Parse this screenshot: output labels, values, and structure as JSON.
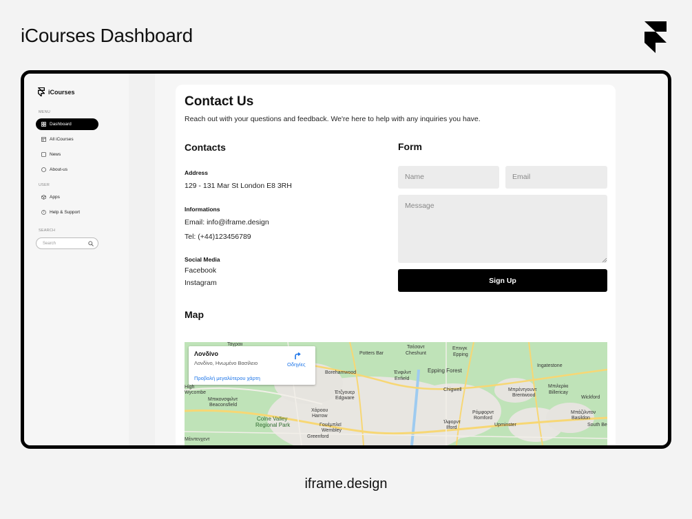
{
  "page": {
    "title": "iCourses Dashboard",
    "footer": "iframe.design"
  },
  "sidebar": {
    "brand": "iCourses",
    "menu_label": "MENU",
    "user_label": "USER",
    "search_label": "SEARCH",
    "search_placeholder": "Search",
    "items": [
      {
        "label": "Dashboard",
        "icon": "grid-icon",
        "active": true
      },
      {
        "label": "All iCourses",
        "icon": "layout-icon",
        "active": false
      },
      {
        "label": "News",
        "icon": "square-icon",
        "active": false
      },
      {
        "label": "About-us",
        "icon": "circle-icon",
        "active": false
      },
      {
        "label": "Apps",
        "icon": "cube-icon",
        "active": false
      },
      {
        "label": "Help & Support",
        "icon": "help-icon",
        "active": false
      }
    ]
  },
  "main": {
    "title": "Contact Us",
    "subtitle": "Reach out with your questions and feedback. We're here to help with any inquiries you have.",
    "contacts": {
      "heading": "Contacts",
      "address_label": "Address",
      "address": "129 - 131 Mar St London E8 3RH",
      "info_label": "Informations",
      "email": "Email: info@iframe.design",
      "phone": "Tel: (+44)123456789",
      "social_label": "Social Media",
      "social": [
        "Facebook",
        "Instagram"
      ]
    },
    "form": {
      "heading": "Form",
      "name_placeholder": "Name",
      "email_placeholder": "Email",
      "message_placeholder": "Message",
      "submit": "Sign Up"
    },
    "map": {
      "heading": "Map",
      "place_title": "Λονδίνο",
      "place_sub": "Λονδίνο, Ηνωμένο Βασίλειο",
      "larger_map": "Προβολή μεγαλύτερου χάρτη",
      "directions": "Οδηγίες",
      "labels": [
        "Potters Bar",
        "Τσέσαντ",
        "Cheshunt",
        "Επινγκ",
        "Epping",
        "Borehamwood",
        "Ένφιλντ",
        "Enfield",
        "Epping Forest",
        "Ingatestone",
        "Μπρέντγουντ",
        "Brentwood",
        "Μπιλερίκι",
        "Billericay",
        "Μπικονσφιλντ",
        "Beaconsfield",
        "Έτζγουερ",
        "Edgware",
        "Chigwell",
        "Wickford",
        "Χάροου",
        "Harrow",
        "Ρόμφορντ",
        "Romford",
        "Μπάζιλντον",
        "Basildon",
        "Colne Valley",
        "Regional Park",
        "Γουέμπλεϊ",
        "Wembley",
        "Ίλφορντ",
        "Ilford",
        "Upminster",
        "South Be",
        "Greenford",
        "Μέιντενχεντ",
        "Wycombe",
        "Τάγραιι",
        "High"
      ]
    }
  }
}
